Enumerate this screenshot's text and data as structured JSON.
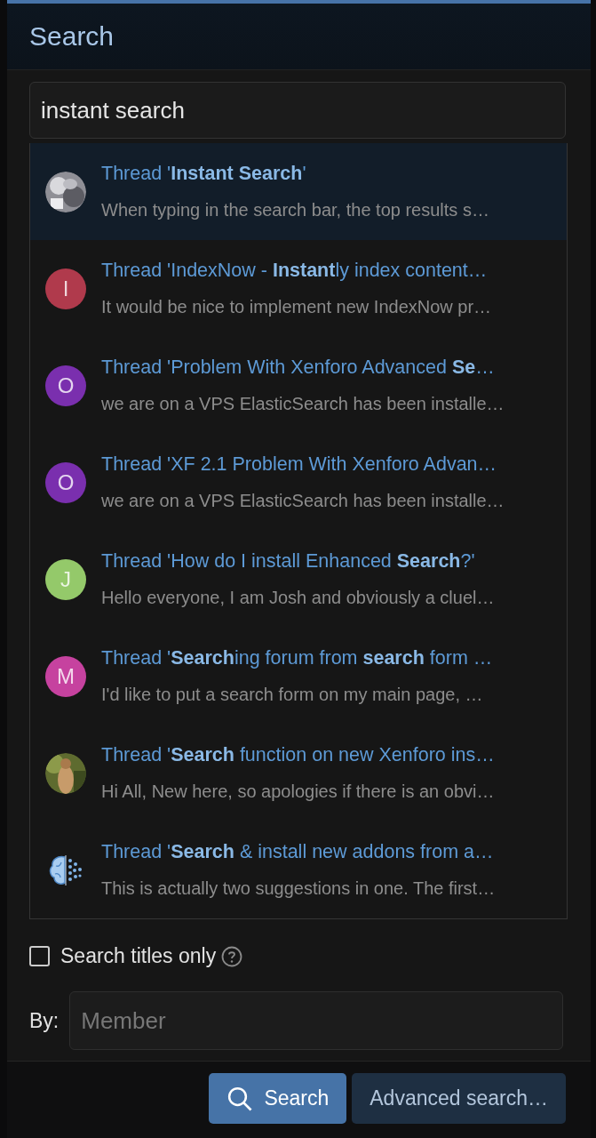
{
  "dialog": {
    "title": "Search"
  },
  "search": {
    "value": "instant search"
  },
  "results": [
    {
      "title": "Thread '**Instant Search**'",
      "snippet": "When typing in the search bar, the top results s…",
      "selected": true
    },
    {
      "title": "Thread 'IndexNow - **Instant**ly index content…",
      "snippet": "It would be nice to implement new IndexNow pr…",
      "selected": false,
      "avatar": {
        "kind": "letter",
        "letter": "I",
        "color": "#b03a4c"
      }
    },
    {
      "title": "Thread 'Problem With Xenforo Advanced **Se**…",
      "snippet": "we are on a VPS ElasticSearch has been installe…",
      "selected": false,
      "avatar": {
        "kind": "letter",
        "letter": "O",
        "color": "#7a2fae"
      }
    },
    {
      "title": "Thread 'XF 2.1 Problem With Xenforo Advan…",
      "snippet": "we are on a VPS ElasticSearch has been installe…",
      "selected": false,
      "avatar": {
        "kind": "letter",
        "letter": "O",
        "color": "#7a2fae"
      }
    },
    {
      "title": "Thread 'How do I install Enhanced **Search**?'",
      "snippet": "Hello everyone, I am Josh and obviously a cluel…",
      "selected": false,
      "avatar": {
        "kind": "letter",
        "letter": "J",
        "color": "#94c96a"
      }
    },
    {
      "title": "Thread '**Search**ing forum from **search** form …",
      "snippet": "I'd like to put a search form on my main page, …",
      "selected": false,
      "avatar": {
        "kind": "letter",
        "letter": "M",
        "color": "#c6429f"
      }
    },
    {
      "title": "Thread '**Search** function on new Xenforo ins…",
      "snippet": "Hi All, New here, so apologies if there is an obvi…",
      "selected": false
    },
    {
      "title": "Thread '**Search** & install new addons from a…",
      "snippet": "This is actually two suggestions in one. The first…",
      "selected": false,
      "avatar": {
        "kind": "brain"
      }
    }
  ],
  "titles_only": {
    "label": "Search titles only",
    "checked": false
  },
  "by": {
    "label": "By:",
    "placeholder": "Member"
  },
  "buttons": [
    {
      "kind": "primary",
      "label": "Search"
    },
    {
      "kind": "secondary",
      "label": "Advanced search…"
    }
  ]
}
